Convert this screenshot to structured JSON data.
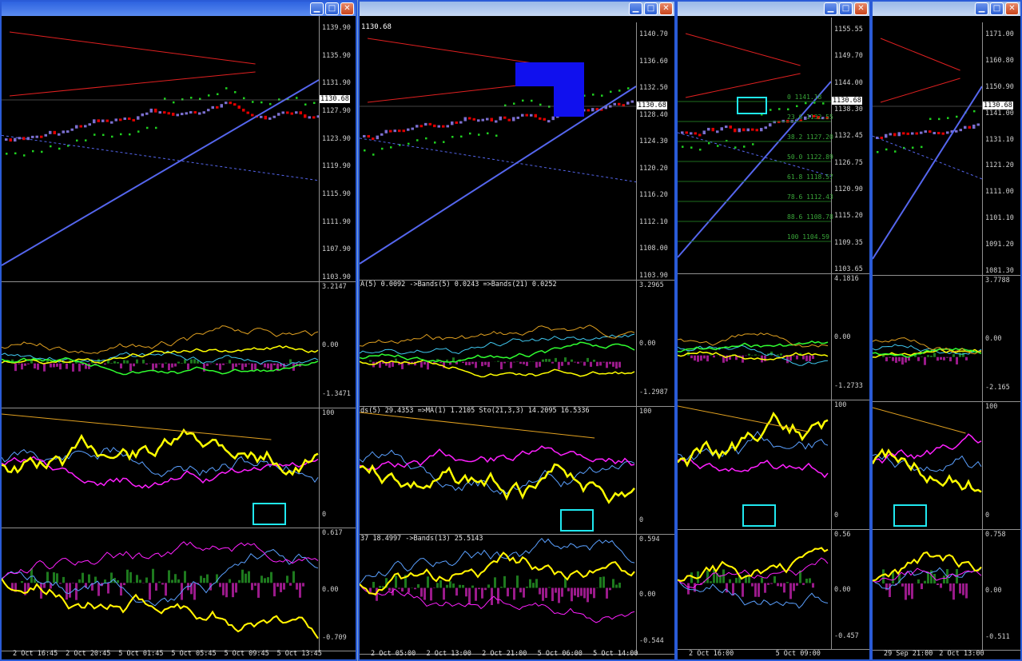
{
  "colors": {
    "bull": "#7b6fd0",
    "bear": "#e00000",
    "psar": "#20d020",
    "trend": "#5566ee",
    "channel_red": "#e02020",
    "orange": "#e0a020",
    "yellow": "#ffff00",
    "magenta": "#ff20ff",
    "cyan_box": "#20e8f0",
    "hist_pos": "#1e7a1e",
    "hist_neg": "#9a1a8a"
  },
  "windows": [
    {
      "symbol_label": "",
      "price_ticks": [
        "1139.90",
        "1135.90",
        "1131.90",
        "1127.90",
        "1123.90",
        "1119.90",
        "1115.90",
        "1111.90",
        "1107.90",
        "1103.90"
      ],
      "current_price": "1130.68",
      "macd_ticks": [
        "3.2147",
        "0.00",
        "-1.3471"
      ],
      "stoch_ticks": [
        "100",
        "0"
      ],
      "osc_ticks": [
        "0.617",
        "0.00",
        "-0.709"
      ],
      "macd_label": "",
      "stoch_label": "",
      "osc_label": "",
      "time_labels": [
        "2 Oct 16:45",
        "2 Oct 20:45",
        "5 Oct 01:45",
        "5 Oct 05:45",
        "5 Oct 09:45",
        "5 Oct 13:45"
      ],
      "fib_labels": []
    },
    {
      "symbol_label": "1130.68",
      "price_ticks": [
        "1140.70",
        "1136.60",
        "1132.50",
        "1128.40",
        "1124.30",
        "1120.20",
        "1116.20",
        "1112.10",
        "1108.00",
        "1103.90"
      ],
      "current_price": "1130.68",
      "macd_ticks": [
        "3.2965",
        "0.00",
        "-1.2987"
      ],
      "stoch_ticks": [
        "100",
        "0"
      ],
      "osc_ticks": [
        "0.594",
        "0.00",
        "-0.544"
      ],
      "macd_label": "A(5) 0.0092  ->Bands(5) 0.0243  =>Bands(21) 0.0252",
      "stoch_label": "ds(5) 29.4353  =>MA(1) 1.2105  Sto(21,3,3) 14.2095 16.5336",
      "osc_label": "37 18.4997  ->Bands(13) 25.5143",
      "time_labels": [
        "2 Oct 05:00",
        "2 Oct 13:00",
        "2 Oct 21:00",
        "5 Oct 06:00",
        "5 Oct 14:00"
      ],
      "fib_labels": []
    },
    {
      "symbol_label": "",
      "price_ticks": [
        "1155.55",
        "1149.70",
        "1144.00",
        "1138.30",
        "1132.45",
        "1126.75",
        "1120.90",
        "1115.20",
        "1109.35",
        "1103.65"
      ],
      "current_price": "1130.68",
      "macd_ticks": [
        "4.1816",
        "0.00",
        "-1.2733"
      ],
      "stoch_ticks": [
        "100",
        "0"
      ],
      "osc_ticks": [
        "0.56",
        "0.00",
        "-0.457"
      ],
      "macd_label": "",
      "stoch_label": "",
      "osc_label": "",
      "time_labels": [
        "2 Oct 16:00",
        "5 Oct 09:00"
      ],
      "fib_labels": [
        "0 1141.18",
        "23.6 1132.55",
        "38.2 1127.20",
        "50.0 1122.89",
        "61.8 1118.57",
        "78.6 1112.43",
        "88.6 1108.78",
        "100 1104.59"
      ]
    },
    {
      "symbol_label": "",
      "price_ticks": [
        "1171.00",
        "1160.80",
        "1150.90",
        "1141.00",
        "1131.10",
        "1121.20",
        "1111.00",
        "1101.10",
        "1091.20",
        "1081.30"
      ],
      "current_price": "1130.68",
      "macd_ticks": [
        "3.7788",
        "0.00",
        "-2.165"
      ],
      "stoch_ticks": [
        "100",
        "0"
      ],
      "osc_ticks": [
        "0.758",
        "0.00",
        "-0.511"
      ],
      "macd_label": "",
      "stoch_label": "",
      "osc_label": "",
      "time_labels": [
        "29 Sep 21:00",
        "2 Oct 13:00"
      ],
      "fib_labels": []
    }
  ]
}
